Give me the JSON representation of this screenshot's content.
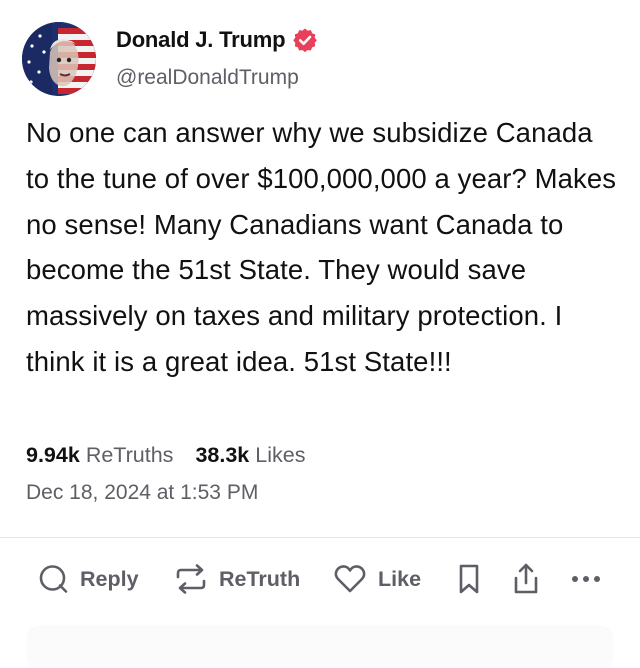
{
  "post": {
    "author": {
      "display_name": "Donald J. Trump",
      "handle": "@realDonaldTrump",
      "verified": true,
      "verified_icon": "verified-badge-icon",
      "accent_color": "#e8405b"
    },
    "text": "No one can answer why we subsidize Canada to the tune of over $100,000,000 a year? Makes no sense! Many Canadians want Canada to become the 51st State. They would save massively on taxes and military protection. I think it is a great idea. 51st State!!!",
    "stats": {
      "retruths_count": "9.94k",
      "retruths_label": "ReTruths",
      "likes_count": "38.3k",
      "likes_label": "Likes"
    },
    "timestamp": "Dec 18, 2024 at 1:53 PM"
  },
  "actions": {
    "reply_label": "Reply",
    "retruth_label": "ReTruth",
    "like_label": "Like",
    "icons": [
      "reply-icon",
      "retruth-icon",
      "like-icon",
      "bookmark-icon",
      "share-icon",
      "more-icon"
    ]
  },
  "colors": {
    "text_primary": "#111111",
    "text_secondary": "#5e5e66",
    "divider": "#e6e6ea"
  }
}
